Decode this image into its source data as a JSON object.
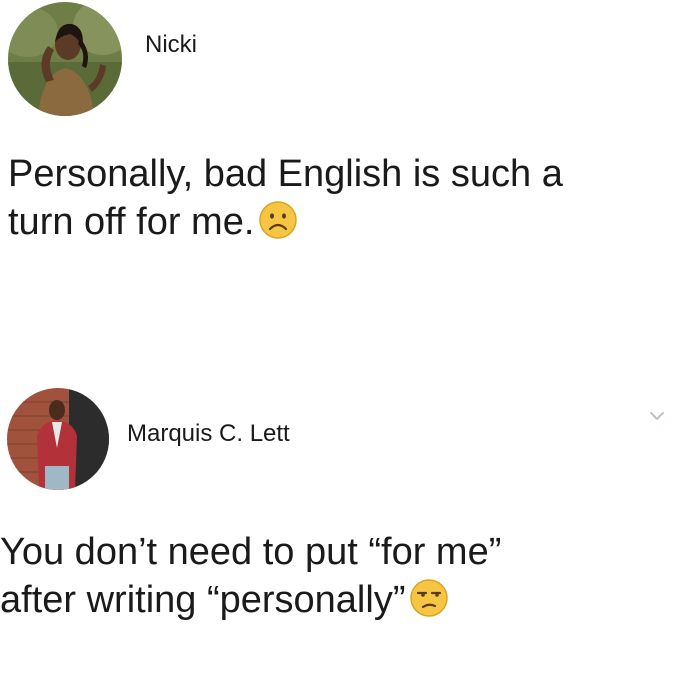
{
  "posts": [
    {
      "author": "Nicki",
      "lines": [
        "Personally, bad English is such a",
        "turn off for me."
      ],
      "emoji": "frowning-face-emoji"
    },
    {
      "author": "Marquis C. Lett",
      "lines": [
        "You don’t need to put “for me”",
        "after writing “personally”"
      ],
      "emoji": "unamused-face-emoji",
      "menu_icon": "chevron-down-icon"
    }
  ],
  "colors": {
    "text": "#1a1a1a",
    "background": "#ffffff",
    "emoji_face": "#f6c543",
    "chevron": "#b8c4cc"
  }
}
